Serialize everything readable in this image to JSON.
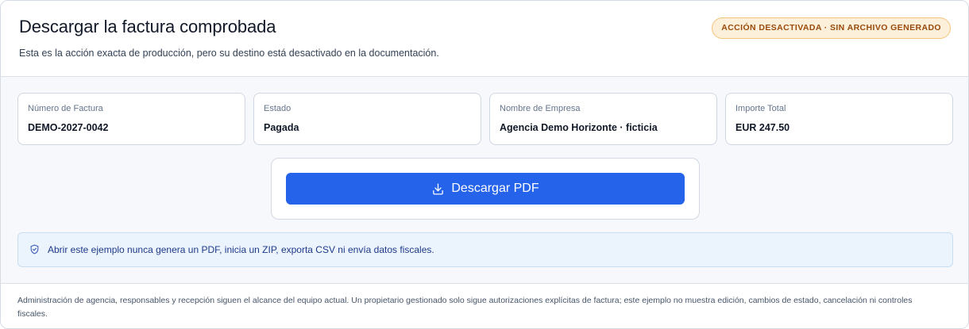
{
  "header": {
    "title": "Descargar la factura comprobada",
    "subtitle": "Esta es la acción exacta de producción, pero su destino está desactivado en la documentación.",
    "badge": "ACCIÓN DESACTIVADA · SIN ARCHIVO GENERADO"
  },
  "fields": [
    {
      "label": "Número de Factura",
      "value": "DEMO-2027-0042"
    },
    {
      "label": "Estado",
      "value": "Pagada"
    },
    {
      "label": "Nombre de Empresa",
      "value": "Agencia Demo Horizonte · ficticia"
    },
    {
      "label": "Importe Total",
      "value": "EUR 247.50"
    }
  ],
  "action": {
    "button_label": "Descargar PDF",
    "button_icon": "download-icon"
  },
  "notice": {
    "icon": "shield-check-icon",
    "text": "Abrir este ejemplo nunca genera un PDF, inicia un ZIP, exporta CSV ni envía datos fiscales."
  },
  "footer": {
    "text": "Administración de agencia, responsables y recepción siguen el alcance del equipo actual. Un propietario gestionado solo sigue autorizaciones explícitas de factura; este ejemplo no muestra edición, cambios de estado, cancelación ni controles fiscales."
  },
  "colors": {
    "primary": "#2563eb",
    "badge_bg": "#fdf0da",
    "badge_text": "#9a4a0c",
    "notice_bg": "#ebf3fd",
    "notice_text": "#1e3a8a"
  }
}
